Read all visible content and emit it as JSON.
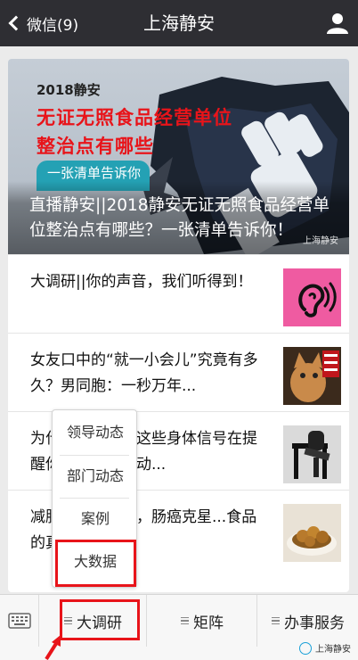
{
  "header": {
    "back_label": "微信(9)",
    "title": "上海静安"
  },
  "banner": {
    "year_line": "2018静安",
    "red_line_1": "无证无照食品经营单位",
    "red_line_2": "整治点有哪些",
    "pill": "一张清单告诉你",
    "caption": "直播静安||2018静安无证无照食品经营单位整治点有哪些？一张清单告诉你！",
    "watermark": "上海静安"
  },
  "articles": [
    {
      "title": "大调研||你的声音，我们听得到！",
      "thumb": "ear-icon"
    },
    {
      "title": "女友口中的“就一小会儿”究竟有多久？男同胞：一秒万年...",
      "thumb": "cat-photo"
    },
    {
      "title": "为什么不舒服？这些身体信号在提醒你，你就该运动...",
      "thumb": "chair-photo"
    },
    {
      "title": "减脂、软化血液，肠癌克星...食品的真相你...",
      "thumb": "food-photo"
    }
  ],
  "popup_menu": {
    "items": [
      "领导动态",
      "部门动态",
      "案例",
      "大数据"
    ]
  },
  "bottom_menu": {
    "items": [
      "大调研",
      "矩阵",
      "办事服务"
    ]
  },
  "footer_watermark": "上海静安",
  "colors": {
    "topbar": "#2e2e33",
    "highlight": "#e8141a",
    "pill": "#24a1b4",
    "ear_bg": "#ef5ba1"
  }
}
